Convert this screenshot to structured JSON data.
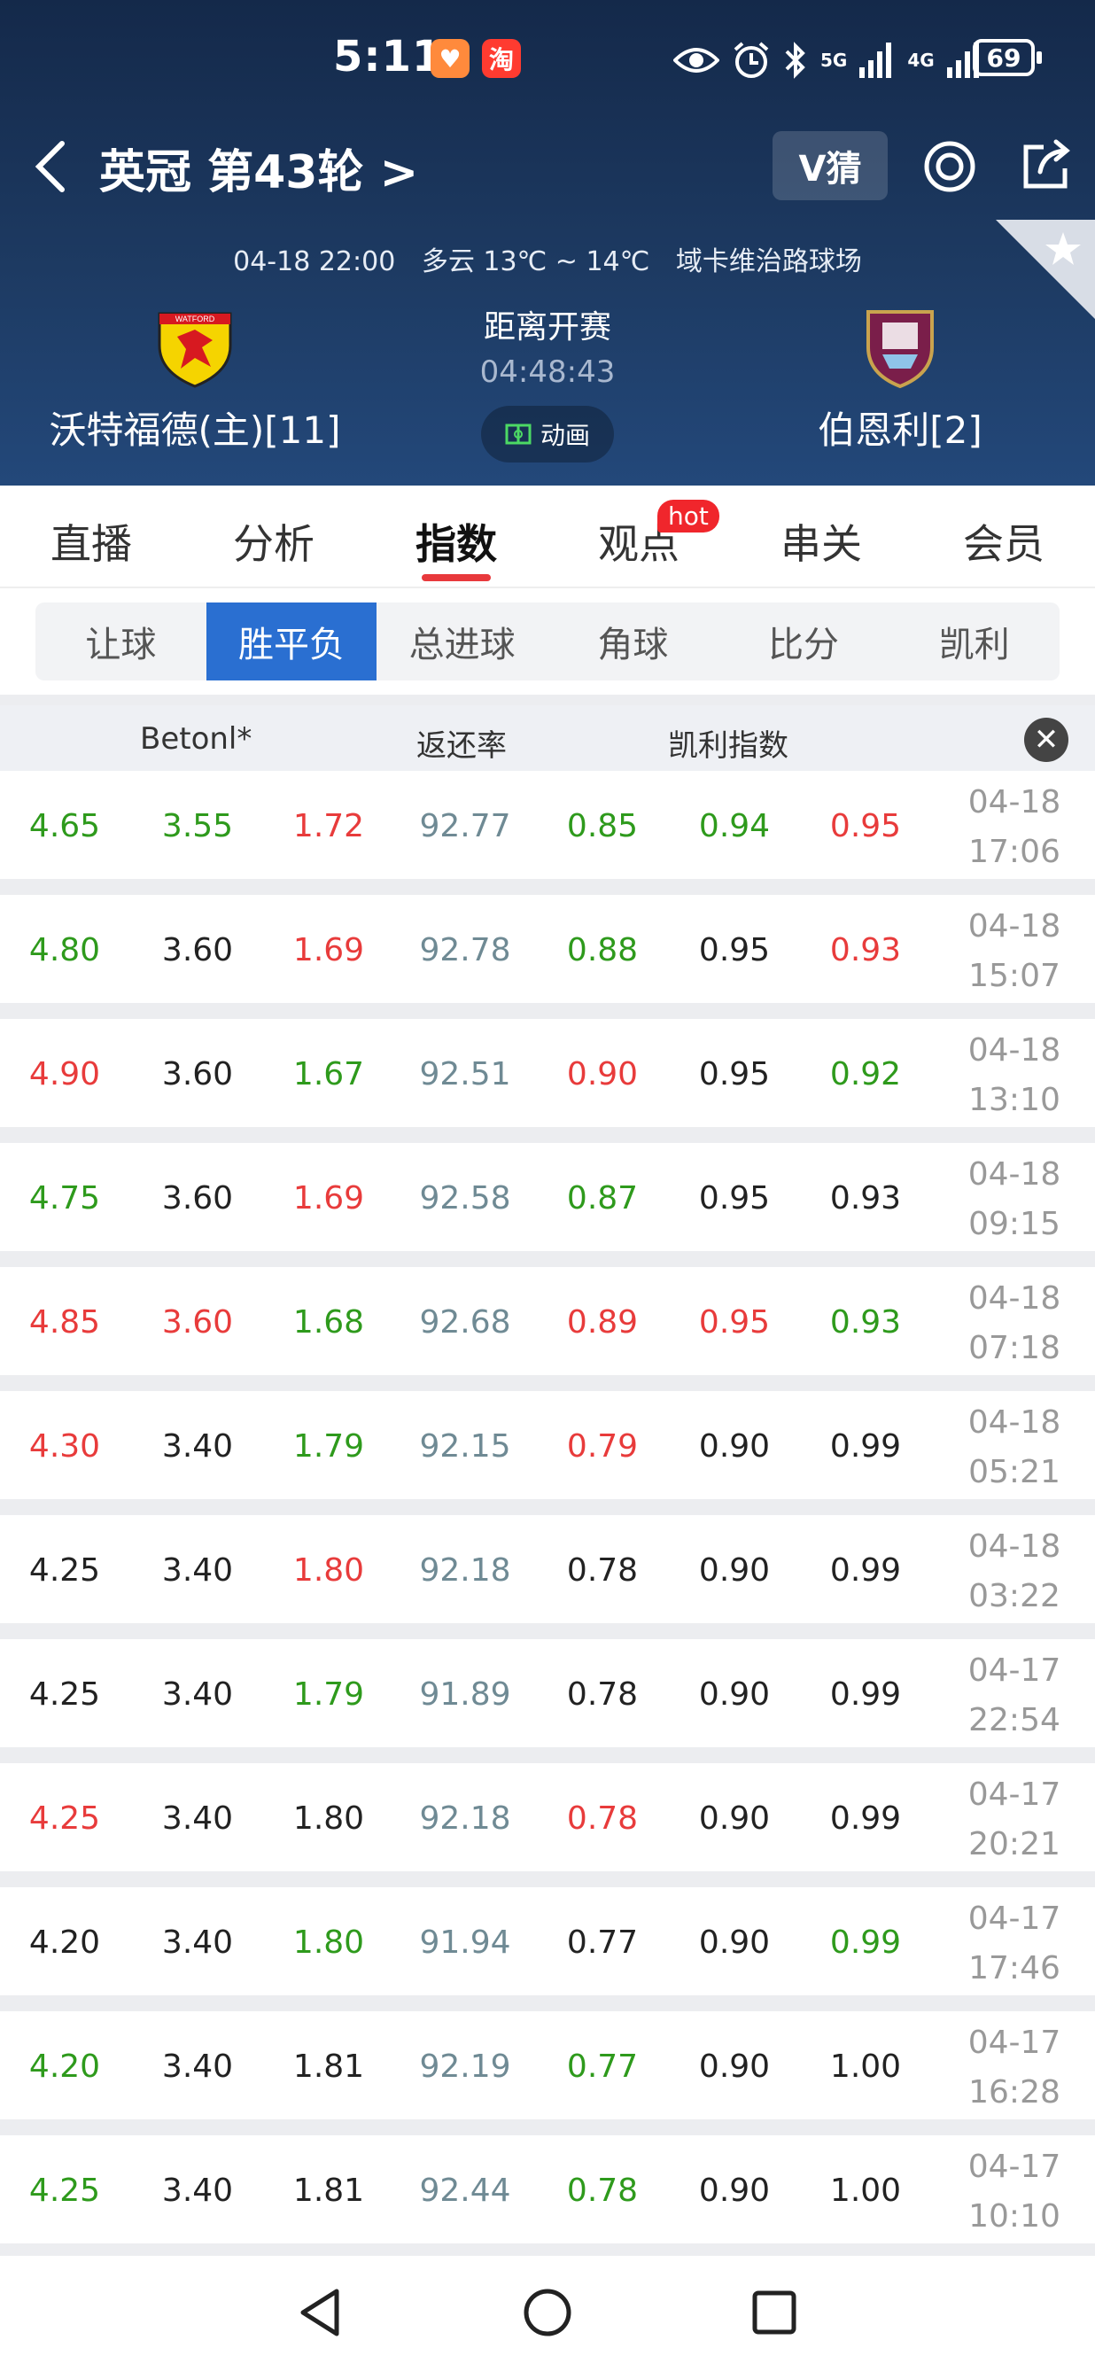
{
  "status_bar": {
    "time": "5:11",
    "app1": "♥",
    "app2": "淘",
    "signal1": "5G",
    "signal2": "4G",
    "battery": "69"
  },
  "header": {
    "title": "英冠 第43轮 >",
    "vguess_label": "V猜",
    "match_date": "04-18 22:00",
    "weather": "多云 13℃ ~ 14℃",
    "venue": "域卡维治路球场",
    "home_team": "沃特福德(主)[11]",
    "away_team": "伯恩利[2]",
    "home_logo_text": "WATFORD",
    "countdown_label": "距离开赛",
    "countdown": "04:48:43",
    "animation_label": "动画"
  },
  "tabs": [
    {
      "label": "直播"
    },
    {
      "label": "分析"
    },
    {
      "label": "指数"
    },
    {
      "label": "观点",
      "badge": "hot"
    },
    {
      "label": "串关"
    },
    {
      "label": "会员"
    }
  ],
  "subtabs": [
    {
      "label": "让球"
    },
    {
      "label": "胜平负"
    },
    {
      "label": "总进球"
    },
    {
      "label": "角球"
    },
    {
      "label": "比分"
    },
    {
      "label": "凯利"
    }
  ],
  "table": {
    "headers": {
      "bookmaker": "Betonl*",
      "return_rate": "返还率",
      "kelly": "凯利指数",
      "close": "✕"
    },
    "rows": [
      {
        "v": [
          "4.65",
          "3.55",
          "1.72",
          "92.77",
          "0.85",
          "0.94",
          "0.95"
        ],
        "c": [
          "green",
          "green",
          "red",
          "",
          "green",
          "green",
          "red"
        ],
        "date": "04-18",
        "time": "17:06"
      },
      {
        "v": [
          "4.80",
          "3.60",
          "1.69",
          "92.78",
          "0.88",
          "0.95",
          "0.93"
        ],
        "c": [
          "green",
          "black",
          "red",
          "",
          "green",
          "black",
          "red"
        ],
        "date": "04-18",
        "time": "15:07"
      },
      {
        "v": [
          "4.90",
          "3.60",
          "1.67",
          "92.51",
          "0.90",
          "0.95",
          "0.92"
        ],
        "c": [
          "red",
          "black",
          "green",
          "",
          "red",
          "black",
          "green"
        ],
        "date": "04-18",
        "time": "13:10"
      },
      {
        "v": [
          "4.75",
          "3.60",
          "1.69",
          "92.58",
          "0.87",
          "0.95",
          "0.93"
        ],
        "c": [
          "green",
          "black",
          "red",
          "",
          "green",
          "black",
          "black"
        ],
        "date": "04-18",
        "time": "09:15"
      },
      {
        "v": [
          "4.85",
          "3.60",
          "1.68",
          "92.68",
          "0.89",
          "0.95",
          "0.93"
        ],
        "c": [
          "red",
          "red",
          "green",
          "",
          "red",
          "red",
          "green"
        ],
        "date": "04-18",
        "time": "07:18"
      },
      {
        "v": [
          "4.30",
          "3.40",
          "1.79",
          "92.15",
          "0.79",
          "0.90",
          "0.99"
        ],
        "c": [
          "red",
          "black",
          "green",
          "",
          "red",
          "black",
          "black"
        ],
        "date": "04-18",
        "time": "05:21"
      },
      {
        "v": [
          "4.25",
          "3.40",
          "1.80",
          "92.18",
          "0.78",
          "0.90",
          "0.99"
        ],
        "c": [
          "black",
          "black",
          "red",
          "",
          "black",
          "black",
          "black"
        ],
        "date": "04-18",
        "time": "03:22"
      },
      {
        "v": [
          "4.25",
          "3.40",
          "1.79",
          "91.89",
          "0.78",
          "0.90",
          "0.99"
        ],
        "c": [
          "black",
          "black",
          "green",
          "",
          "black",
          "black",
          "black"
        ],
        "date": "04-17",
        "time": "22:54"
      },
      {
        "v": [
          "4.25",
          "3.40",
          "1.80",
          "92.18",
          "0.78",
          "0.90",
          "0.99"
        ],
        "c": [
          "red",
          "black",
          "black",
          "",
          "red",
          "black",
          "black"
        ],
        "date": "04-17",
        "time": "20:21"
      },
      {
        "v": [
          "4.20",
          "3.40",
          "1.80",
          "91.94",
          "0.77",
          "0.90",
          "0.99"
        ],
        "c": [
          "black",
          "black",
          "green",
          "",
          "black",
          "black",
          "green"
        ],
        "date": "04-17",
        "time": "17:46"
      },
      {
        "v": [
          "4.20",
          "3.40",
          "1.81",
          "92.19",
          "0.77",
          "0.90",
          "1.00"
        ],
        "c": [
          "green",
          "black",
          "black",
          "",
          "green",
          "black",
          "black"
        ],
        "date": "04-17",
        "time": "16:28"
      },
      {
        "v": [
          "4.25",
          "3.40",
          "1.81",
          "92.44",
          "0.78",
          "0.90",
          "1.00"
        ],
        "c": [
          "green",
          "black",
          "black",
          "",
          "green",
          "black",
          "black"
        ],
        "date": "04-17",
        "time": "10:10"
      }
    ]
  },
  "colors": {
    "header_top": "#14294a",
    "accent_blue": "#2a6fd1",
    "up_red": "#e83b3b",
    "down_green": "#2e9a1c"
  },
  "icons": {
    "back": "chevron-left-icon",
    "target": "target-icon",
    "share": "share-icon",
    "star": "star-icon",
    "close": "close-icon"
  }
}
